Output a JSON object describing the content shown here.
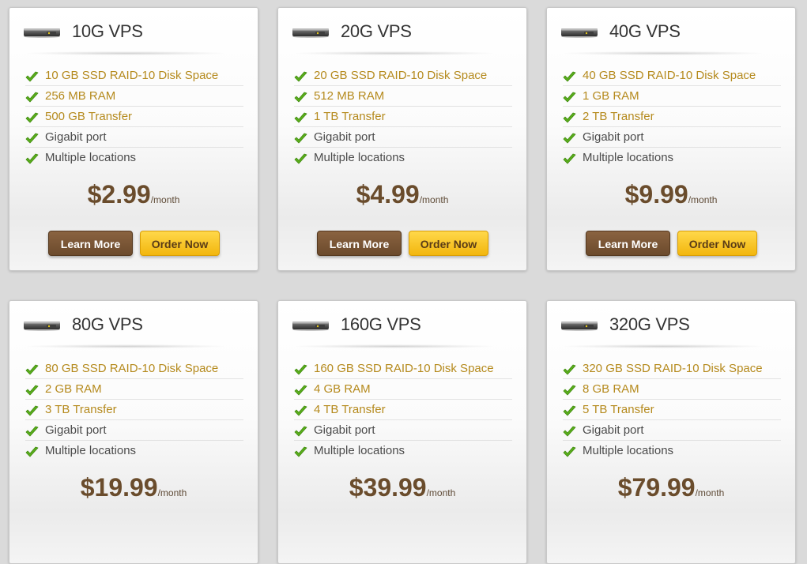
{
  "colors": {
    "page_background": "#dadada",
    "card_background": "#ffffff",
    "highlight_text": "#b58a1d",
    "plain_text": "#4b4b4b",
    "price_text": "#6a4c2c",
    "learn_more_button": "#6b4a2c",
    "order_now_button": "#f2b60e",
    "check_icon": "#5aad1c"
  },
  "icons": {
    "server": "server-icon",
    "check": "checkmark-icon"
  },
  "plans": [
    {
      "title": "10G VPS",
      "features": [
        {
          "text": "10 GB SSD RAID-10 Disk Space",
          "style": "highlight"
        },
        {
          "text": "256 MB RAM",
          "style": "highlight"
        },
        {
          "text": "500 GB Transfer",
          "style": "highlight"
        },
        {
          "text": "Gigabit port",
          "style": "plain"
        },
        {
          "text": "Multiple locations",
          "style": "plain"
        }
      ],
      "price": "$2.99",
      "period": "/month",
      "learn_more": "Learn More",
      "order_now": "Order Now"
    },
    {
      "title": "20G VPS",
      "features": [
        {
          "text": "20 GB SSD RAID-10 Disk Space",
          "style": "highlight"
        },
        {
          "text": "512 MB RAM",
          "style": "highlight"
        },
        {
          "text": "1 TB Transfer",
          "style": "highlight"
        },
        {
          "text": "Gigabit port",
          "style": "plain"
        },
        {
          "text": "Multiple locations",
          "style": "plain"
        }
      ],
      "price": "$4.99",
      "period": "/month",
      "learn_more": "Learn More",
      "order_now": "Order Now"
    },
    {
      "title": "40G VPS",
      "features": [
        {
          "text": "40 GB SSD RAID-10 Disk Space",
          "style": "highlight"
        },
        {
          "text": "1 GB RAM",
          "style": "highlight"
        },
        {
          "text": "2 TB Transfer",
          "style": "highlight"
        },
        {
          "text": "Gigabit port",
          "style": "plain"
        },
        {
          "text": "Multiple locations",
          "style": "plain"
        }
      ],
      "price": "$9.99",
      "period": "/month",
      "learn_more": "Learn More",
      "order_now": "Order Now"
    },
    {
      "title": "80G VPS",
      "features": [
        {
          "text": "80 GB SSD RAID-10 Disk Space",
          "style": "highlight"
        },
        {
          "text": "2 GB RAM",
          "style": "highlight"
        },
        {
          "text": "3 TB Transfer",
          "style": "highlight"
        },
        {
          "text": "Gigabit port",
          "style": "plain"
        },
        {
          "text": "Multiple locations",
          "style": "plain"
        }
      ],
      "price": "$19.99",
      "period": "/month"
    },
    {
      "title": "160G VPS",
      "features": [
        {
          "text": "160 GB SSD RAID-10 Disk Space",
          "style": "highlight"
        },
        {
          "text": "4 GB RAM",
          "style": "highlight"
        },
        {
          "text": "4 TB Transfer",
          "style": "highlight"
        },
        {
          "text": "Gigabit port",
          "style": "plain"
        },
        {
          "text": "Multiple locations",
          "style": "plain"
        }
      ],
      "price": "$39.99",
      "period": "/month"
    },
    {
      "title": "320G VPS",
      "features": [
        {
          "text": "320 GB SSD RAID-10 Disk Space",
          "style": "highlight"
        },
        {
          "text": "8 GB RAM",
          "style": "highlight"
        },
        {
          "text": "5 TB Transfer",
          "style": "highlight"
        },
        {
          "text": "Gigabit port",
          "style": "plain"
        },
        {
          "text": "Multiple locations",
          "style": "plain"
        }
      ],
      "price": "$79.99",
      "period": "/month"
    }
  ]
}
